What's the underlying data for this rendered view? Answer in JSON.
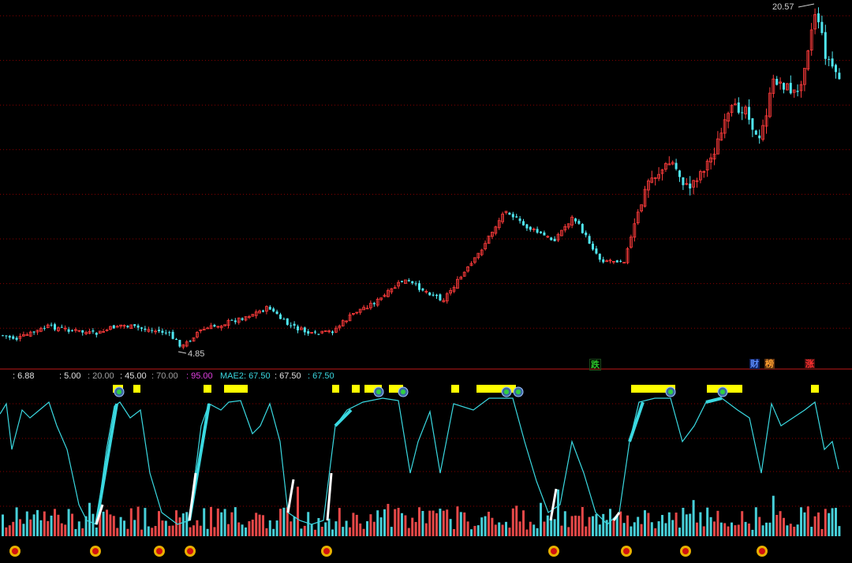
{
  "price_panel": {
    "high_label": "20.57",
    "low_label": "4.85",
    "up_color": "#ff3b3b",
    "down_color": "#4fe6f0",
    "grid_color": "#8a0000"
  },
  "event_tags": [
    {
      "text": "跌",
      "color": "#29c429"
    },
    {
      "text": "财",
      "color": "#5a8cff"
    },
    {
      "text": "榜",
      "color": "#ffa030"
    },
    {
      "text": "涨",
      "color": "#ff3030"
    }
  ],
  "indicator_header": {
    "v1": ": 6.88",
    "v2": ": 5.00",
    "v3": ": 20.00",
    "v4": ": 45.00",
    "v5": ": 70.00",
    "v6": ": 95.00",
    "v7": "MAE2: 67.50",
    "v8": ": 67.50",
    "v9": ": 67.50"
  },
  "indicator_colors": {
    "curve": "#3ad8e0",
    "yellow_block": "#ffff00",
    "white_rise": "#ffffff"
  },
  "bottom_markers": {
    "icon": "star-circle-icon",
    "count": 10
  }
}
